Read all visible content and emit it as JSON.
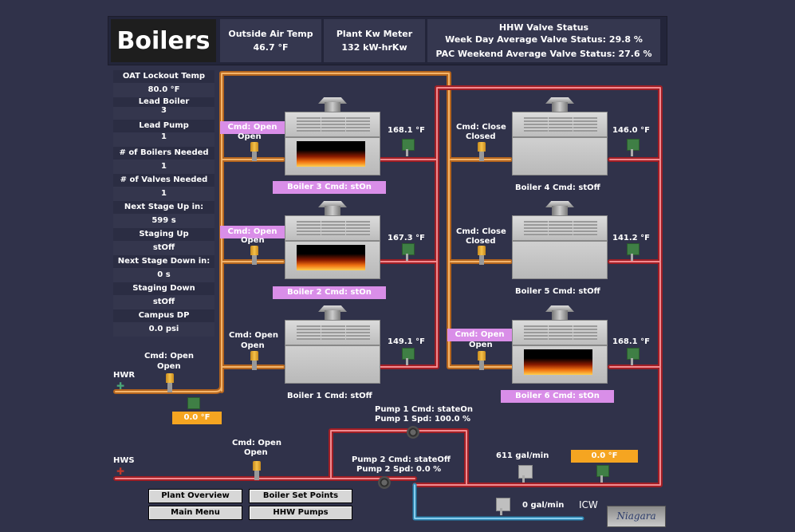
{
  "header": {
    "title": "Boilers",
    "outside_air_temp": {
      "label": "Outside Air Temp",
      "value": "46.7 °F"
    },
    "plant_kw_meter": {
      "label": "Plant Kw Meter",
      "value": "132 kW-hrKw"
    },
    "hhw_valve_status": {
      "label": "HHW Valve Status",
      "weekday": "Week Day Average Valve Status: 29.8 %",
      "weekend": "PAC Weekend Average Valve Status: 27.6 %"
    }
  },
  "sidebar": [
    {
      "label": "OAT Lockout Temp",
      "value": "80.0 °F"
    },
    {
      "label": "Lead Boiler",
      "value": "3"
    },
    {
      "label": "Lead Pump",
      "value": "1"
    },
    {
      "label": "# of Boilers Needed",
      "value": "1"
    },
    {
      "label": "# of Valves Needed",
      "value": "1"
    },
    {
      "label": "Next Stage Up in:",
      "value": "599 s"
    },
    {
      "label": "Staging Up",
      "value": "stOff"
    },
    {
      "label": "Next Stage Down in:",
      "value": "0 s"
    },
    {
      "label": "Staging Down",
      "value": "stOff"
    },
    {
      "label": "Campus DP",
      "value": "0.0 psi"
    }
  ],
  "boilers": [
    {
      "id": 3,
      "label": "Boiler 3 Cmd: stOn",
      "valve_cmd": "Cmd: Open",
      "valve_status": "Open",
      "temp": "168.1 °F",
      "firing": true
    },
    {
      "id": 4,
      "label": "Boiler 4 Cmd: stOff",
      "valve_cmd": "Cmd: Close",
      "valve_status": "Closed",
      "temp": "146.0 °F",
      "firing": false
    },
    {
      "id": 2,
      "label": "Boiler 2 Cmd: stOn",
      "valve_cmd": "Cmd: Open",
      "valve_status": "Open",
      "temp": "167.3 °F",
      "firing": true
    },
    {
      "id": 5,
      "label": "Boiler 5 Cmd: stOff",
      "valve_cmd": "Cmd: Close",
      "valve_status": "Closed",
      "temp": "141.2 °F",
      "firing": false
    },
    {
      "id": 1,
      "label": "Boiler 1 Cmd: stOff",
      "valve_cmd": "Cmd: Open",
      "valve_status": "Open",
      "temp": "149.1 °F",
      "firing": false
    },
    {
      "id": 6,
      "label": "Boiler 6 Cmd: stOn",
      "valve_cmd": "Cmd: Open",
      "valve_status": "Open",
      "temp": "168.1 °F",
      "firing": true
    }
  ],
  "hwr": {
    "label": "HWR",
    "valve_cmd": "Cmd: Open",
    "valve_status": "Open",
    "temp": "0.0 °F"
  },
  "hws": {
    "label": "HWS",
    "valve_cmd": "Cmd: Open",
    "valve_status": "Open"
  },
  "pumps": [
    {
      "cmd": "Pump 1 Cmd: stateOn",
      "spd": "Pump 1 Spd: 100.0 %"
    },
    {
      "cmd": "Pump 2 Cmd: stateOff",
      "spd": "Pump 2 Spd: 0.0 %"
    }
  ],
  "flow_main": "611 gal/min",
  "supply_temp": "0.0 °F",
  "icw": {
    "label": "ICW",
    "flow": "0 gal/min"
  },
  "buttons": {
    "plant_overview": "Plant Overview",
    "boiler_set_points": "Boiler Set Points",
    "main_menu": "Main Menu",
    "hhw_pumps": "HHW Pumps"
  },
  "colors": {
    "active_label": "#d98ee8",
    "temp_badge": "#f5a521",
    "return_pipe": "#e0892a",
    "supply_pipe": "#d8323a",
    "icw_pipe": "#4fb4e0"
  }
}
